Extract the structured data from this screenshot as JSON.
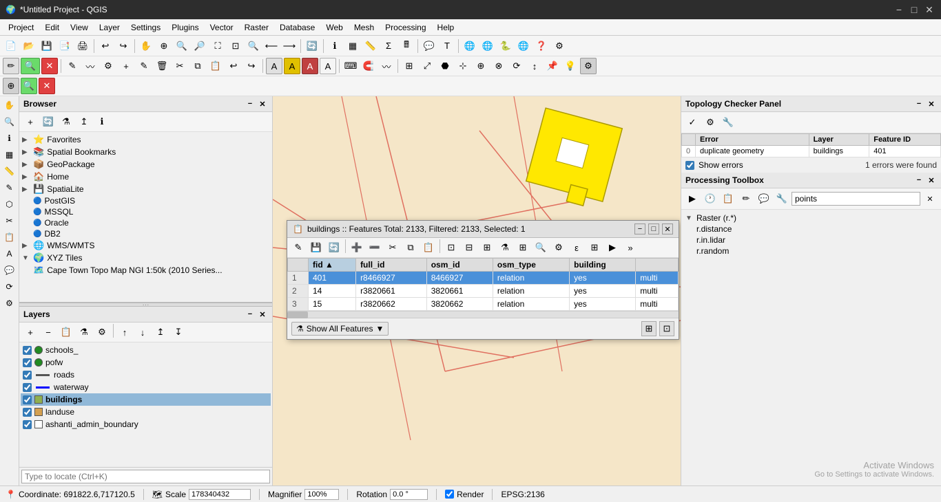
{
  "titleBar": {
    "title": "*Untitled Project - QGIS",
    "minimize": "−",
    "maximize": "□",
    "close": "✕"
  },
  "menuBar": {
    "items": [
      "Project",
      "Edit",
      "View",
      "Layer",
      "Settings",
      "Plugins",
      "Vector",
      "Raster",
      "Database",
      "Web",
      "Mesh",
      "Processing",
      "Help"
    ]
  },
  "browser": {
    "title": "Browser",
    "items": [
      {
        "label": "Favorites",
        "icon": "⭐",
        "hasChildren": false
      },
      {
        "label": "Spatial Bookmarks",
        "icon": "📚",
        "hasChildren": false
      },
      {
        "label": "GeoPackage",
        "icon": "📦",
        "hasChildren": false
      },
      {
        "label": "Home",
        "icon": "🏠",
        "hasChildren": false
      },
      {
        "label": "SpatiaLite",
        "icon": "💾",
        "hasChildren": false
      },
      {
        "label": "PostGIS",
        "icon": "🔵",
        "hasChildren": false
      },
      {
        "label": "MSSQL",
        "icon": "🔵",
        "hasChildren": false
      },
      {
        "label": "Oracle",
        "icon": "🔵",
        "hasChildren": false
      },
      {
        "label": "DB2",
        "icon": "🔵",
        "hasChildren": false
      },
      {
        "label": "WMS/WMTS",
        "icon": "🌐",
        "hasChildren": false
      },
      {
        "label": "XYZ Tiles",
        "icon": "🌍",
        "hasChildren": true,
        "expanded": true
      },
      {
        "label": "Cape Town Topo Map NGI 1:50k (2010 Series...",
        "icon": "🗺️",
        "hasChildren": false,
        "indent": true
      }
    ]
  },
  "layers": {
    "title": "Layers",
    "items": [
      {
        "name": "schools_",
        "checked": true,
        "color": "#228B22",
        "type": "point",
        "active": false
      },
      {
        "name": "pofw",
        "checked": true,
        "color": "#228B22",
        "type": "point",
        "active": false
      },
      {
        "name": "roads",
        "checked": true,
        "color": "#555555",
        "type": "line",
        "active": false
      },
      {
        "name": "waterway",
        "checked": true,
        "color": "#0000FF",
        "type": "line",
        "active": false
      },
      {
        "name": "buildings",
        "checked": true,
        "color": "#90B050",
        "type": "fill",
        "active": true,
        "highlighted": true
      },
      {
        "name": "landuse",
        "checked": true,
        "color": "#d4a050",
        "type": "fill",
        "active": false
      },
      {
        "name": "ashanti_admin_boundary",
        "checked": true,
        "color": "#ffffff",
        "type": "fill",
        "active": false
      }
    ]
  },
  "topologyChecker": {
    "title": "Topology Checker Panel",
    "columns": [
      "",
      "Error",
      "Layer",
      "Feature ID"
    ],
    "rows": [
      {
        "idx": "0",
        "error": "duplicate geometry",
        "layer": "buildings",
        "featureId": "401"
      }
    ],
    "showErrors": "Show errors",
    "errorCount": "1 errors were found"
  },
  "processingToolbox": {
    "title": "Processing Toolbox",
    "searchPlaceholder": "points",
    "tree": [
      {
        "label": "Raster (r.*)",
        "expanded": true,
        "children": [
          {
            "label": "r.distance"
          },
          {
            "label": "r.in.lidar"
          },
          {
            "label": "r.random"
          }
        ]
      }
    ]
  },
  "attrTable": {
    "title": "buildings :: Features Total: 2133, Filtered: 2133, Selected: 1",
    "columns": [
      "fid",
      "full_id",
      "osm_id",
      "osm_type",
      "building",
      ""
    ],
    "rows": [
      {
        "rowNum": "1",
        "fid": "401",
        "full_id": "r8466927",
        "osm_id": "8466927",
        "osm_type": "relation",
        "building": "yes",
        "extra": "multi",
        "selected": true
      },
      {
        "rowNum": "2",
        "fid": "14",
        "full_id": "r3820661",
        "osm_id": "3820661",
        "osm_type": "relation",
        "building": "yes",
        "extra": "multi",
        "selected": false
      },
      {
        "rowNum": "3",
        "fid": "15",
        "full_id": "r3820662",
        "osm_id": "3820662",
        "osm_type": "relation",
        "building": "yes",
        "extra": "multi",
        "selected": false
      }
    ],
    "showAllFeatures": "Show All Features"
  },
  "statusBar": {
    "coordinate": "Coordinate: 691822.6,717120.5",
    "scaleLabel": "Scale",
    "scaleValue": "178340432",
    "magnifierLabel": "Magnifier",
    "magnifierValue": "100%",
    "rotationLabel": "Rotation",
    "rotationValue": "0.0 °",
    "renderLabel": "Render",
    "epsg": "EPSG:2136"
  },
  "searchBar": {
    "placeholder": "Type to locate (Ctrl+K)"
  },
  "icons": {
    "arrow_right": "▶",
    "arrow_down": "▼",
    "check": "✓",
    "star": "⭐",
    "filter": "⚗",
    "gear": "⚙",
    "search": "🔍",
    "close": "✕",
    "minimize": "−",
    "maximize": "□"
  }
}
